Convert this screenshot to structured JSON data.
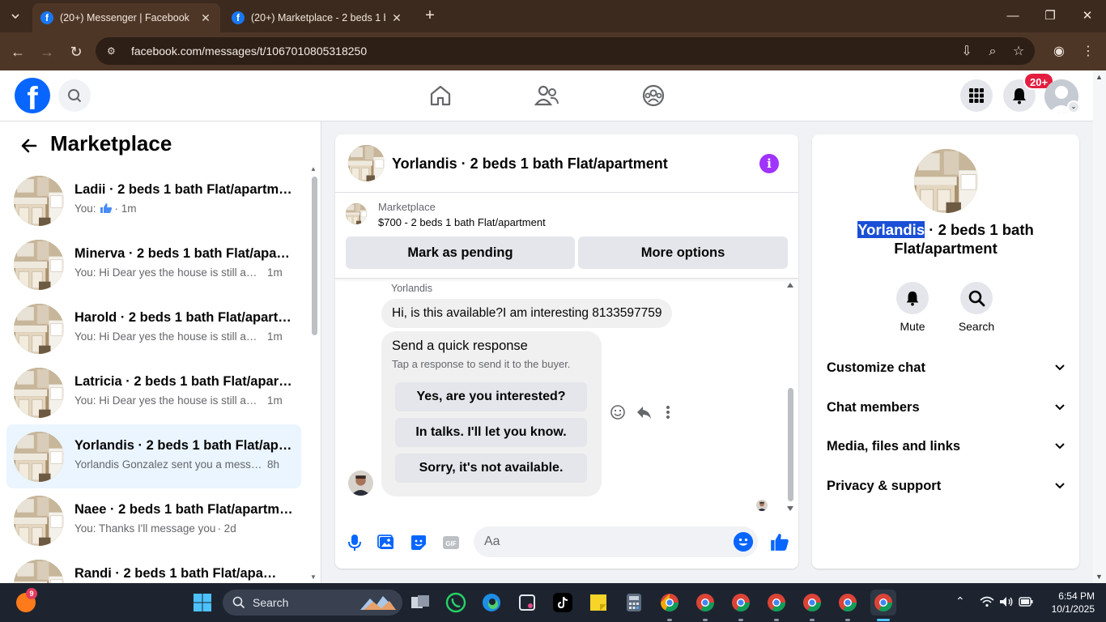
{
  "browser": {
    "tabs": [
      {
        "title": "(20+) Messenger | Facebook",
        "active": true
      },
      {
        "title": "(20+) Marketplace - 2 beds 1 b",
        "active": false
      }
    ],
    "url": "facebook.com/messages/t/1067010805318250"
  },
  "fb": {
    "logo_letter": "f",
    "notifications_badge": "20+"
  },
  "sidebar": {
    "title": "Marketplace",
    "conversations": [
      {
        "name": "Ladii · 2 beds 1 bath Flat/apartment",
        "preview": "You:",
        "preview_icon": "like-icon",
        "time": "· 1m",
        "active": false
      },
      {
        "name": "Minerva · 2 beds 1 bath Flat/apartment",
        "preview": "You: Hi Dear yes the house is still available",
        "time": "1m",
        "active": false
      },
      {
        "name": "Harold · 2 beds 1 bath Flat/apartment",
        "preview": "You: Hi Dear yes the house is still available",
        "time": "1m",
        "active": false
      },
      {
        "name": "Latricia · 2 beds 1 bath Flat/apartment",
        "preview": "You: Hi Dear yes the house is still available",
        "time": "1m",
        "active": false
      },
      {
        "name": "Yorlandis · 2 beds 1 bath Flat/apartment",
        "preview": "Yorlandis Gonzalez sent you a message",
        "time": "8h",
        "active": true
      },
      {
        "name": "Naee · 2 beds 1 bath Flat/apartment",
        "preview": "You: Thanks I'll message you",
        "time": "· 2d",
        "active": false
      },
      {
        "name": "Randi · 2 beds 1 bath Flat/apartment",
        "preview": "",
        "time": "",
        "active": false
      }
    ]
  },
  "chat": {
    "title": "Yorlandis · 2 beds 1 bath Flat/apartment",
    "listing": {
      "label": "Marketplace",
      "price_title": "$700 - 2 beds 1 bath Flat/apartment",
      "mark_pending": "Mark as pending",
      "more_options": "More options"
    },
    "sender_name": "Yorlandis",
    "message": "Hi, is this available?I am interesting 8133597759",
    "quick_response": {
      "title": "Send a quick response",
      "subtitle": "Tap a response to send it to the buyer.",
      "options": [
        "Yes, are you interested?",
        "In talks. I'll let you know.",
        "Sorry, it's not available."
      ]
    },
    "composer_placeholder": "Aa"
  },
  "info_panel": {
    "name_highlight": "Yorlandis",
    "name_rest": " · 2 beds 1 bath Flat/apartment",
    "actions": [
      {
        "label": "Mute"
      },
      {
        "label": "Search"
      }
    ],
    "sections": [
      "Customize chat",
      "Chat members",
      "Media, files and links",
      "Privacy & support"
    ]
  },
  "taskbar": {
    "weather_badge": "9",
    "search_label": "Search",
    "time": "6:54 PM",
    "date": "10/1/2025"
  },
  "colors": {
    "fb_blue": "#0866ff",
    "active_conv_bg": "#ebf5ff",
    "info_purple": "#a033ff",
    "badge_red": "#e41e3f"
  }
}
